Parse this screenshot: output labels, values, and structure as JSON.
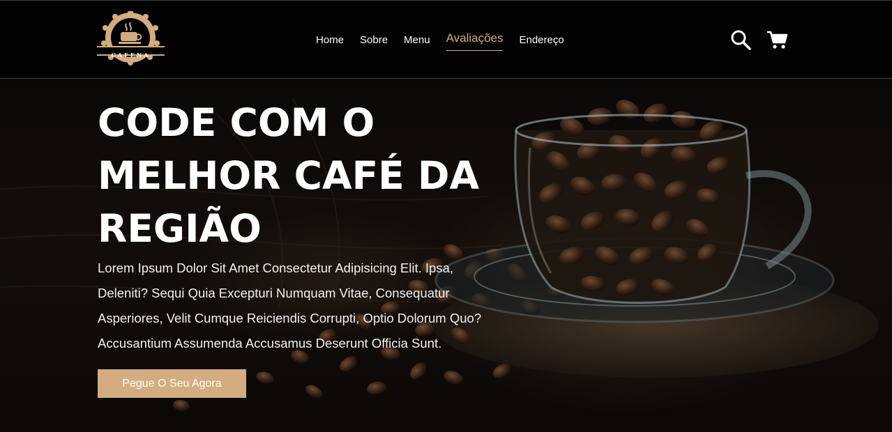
{
  "brand": {
    "logo_text": "CAFENA",
    "accent_color": "#d3ad7f",
    "header_bg": "#020202"
  },
  "nav": {
    "items": [
      {
        "label": "Home",
        "active": false
      },
      {
        "label": "Sobre",
        "active": false
      },
      {
        "label": "Menu",
        "active": false
      },
      {
        "label": "Avaliações",
        "active": true
      },
      {
        "label": "Endereço",
        "active": false
      }
    ]
  },
  "header_icons": {
    "search": "search-icon",
    "cart": "cart-icon"
  },
  "hero": {
    "title_lines": [
      "CODE COM O",
      "MELHOR CAFÉ DA",
      "REGIÃO"
    ],
    "text_lines": [
      "Lorem Ipsum Dolor Sit Amet Consectetur Adipisicing Elit. Ipsa,",
      "Deleniti? Sequi Quia Excepturi Numquam Vitae, Consequatur",
      "Asperiores, Velit Cumque Reiciendis Corrupti, Optio Dolorum Quo?",
      "Accusantium Assumenda Accusamus Deserunt Officia Sunt."
    ],
    "cta_label": "Pegue O Seu Agora"
  }
}
